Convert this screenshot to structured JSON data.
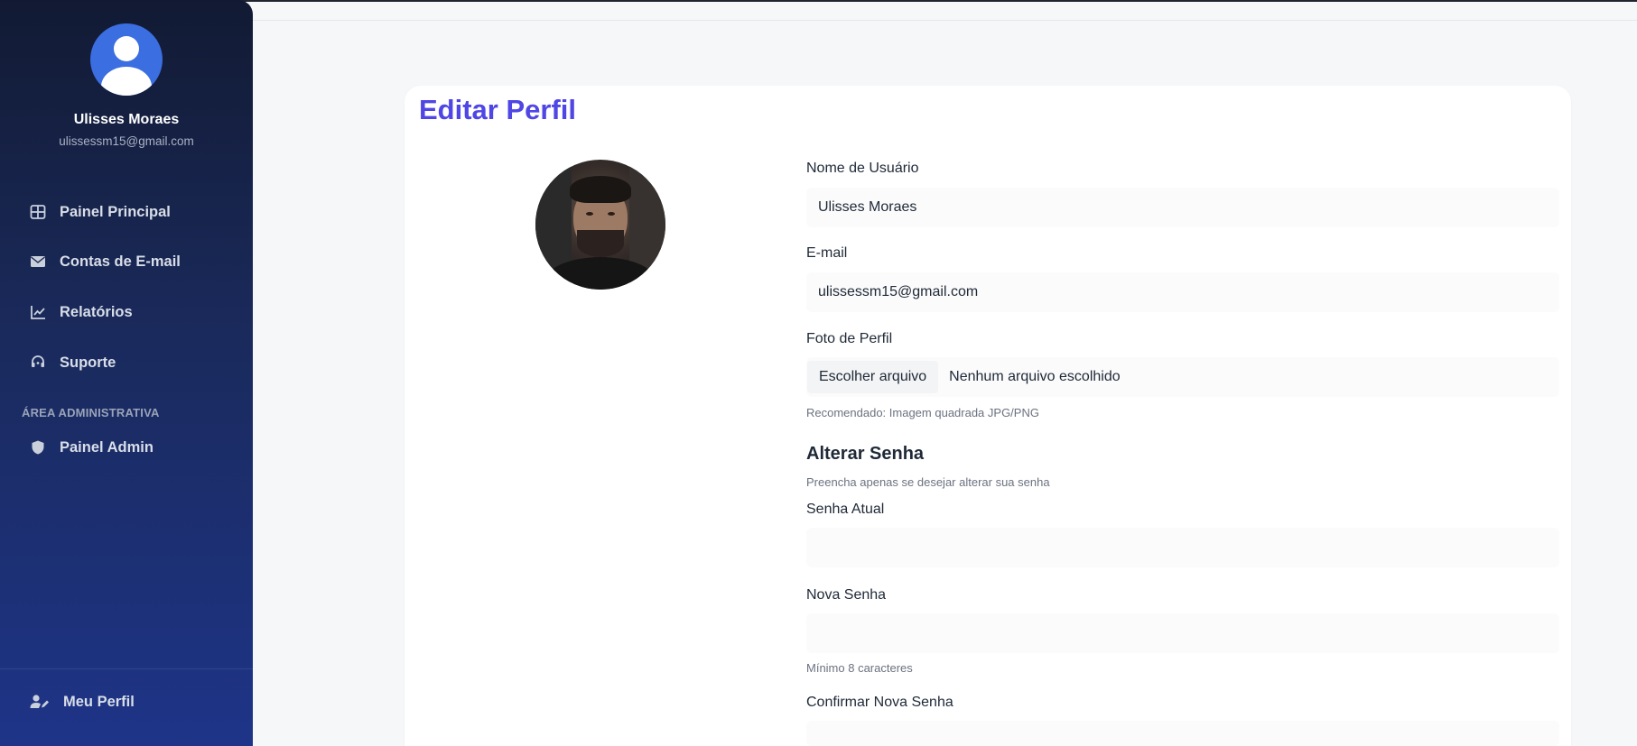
{
  "sidebar": {
    "user": {
      "name": "Ulisses Moraes",
      "email": "ulissessm15@gmail.com",
      "avatar_icon": "user-avatar-icon",
      "avatar_color": "#3b6ee0"
    },
    "nav": [
      {
        "label": "Painel Principal",
        "icon": "grid-icon"
      },
      {
        "label": "Contas de E-mail",
        "icon": "envelope-icon"
      },
      {
        "label": "Relatórios",
        "icon": "chart-line-icon"
      },
      {
        "label": "Suporte",
        "icon": "headset-icon"
      }
    ],
    "admin_section_label": "ÁREA ADMINISTRATIVA",
    "admin_nav": [
      {
        "label": "Painel Admin",
        "icon": "shield-icon"
      }
    ],
    "profile_item": {
      "label": "Meu Perfil",
      "icon": "user-edit-icon"
    }
  },
  "page": {
    "title": "Editar Perfil",
    "accent_color": "#4f46e5"
  },
  "form": {
    "username": {
      "label": "Nome de Usuário",
      "value": "Ulisses Moraes"
    },
    "email": {
      "label": "E-mail",
      "value": "ulissessm15@gmail.com"
    },
    "photo": {
      "label": "Foto de Perfil",
      "button_label": "Escolher arquivo",
      "status": "Nenhum arquivo escolhido",
      "hint": "Recomendado: Imagem quadrada JPG/PNG"
    },
    "password_section": {
      "title": "Alterar Senha",
      "subtitle": "Preencha apenas se desejar alterar sua senha"
    },
    "current_password": {
      "label": "Senha Atual",
      "value": ""
    },
    "new_password": {
      "label": "Nova Senha",
      "value": "",
      "hint": "Mínimo 8 caracteres"
    },
    "confirm_password": {
      "label": "Confirmar Nova Senha",
      "value": ""
    }
  }
}
